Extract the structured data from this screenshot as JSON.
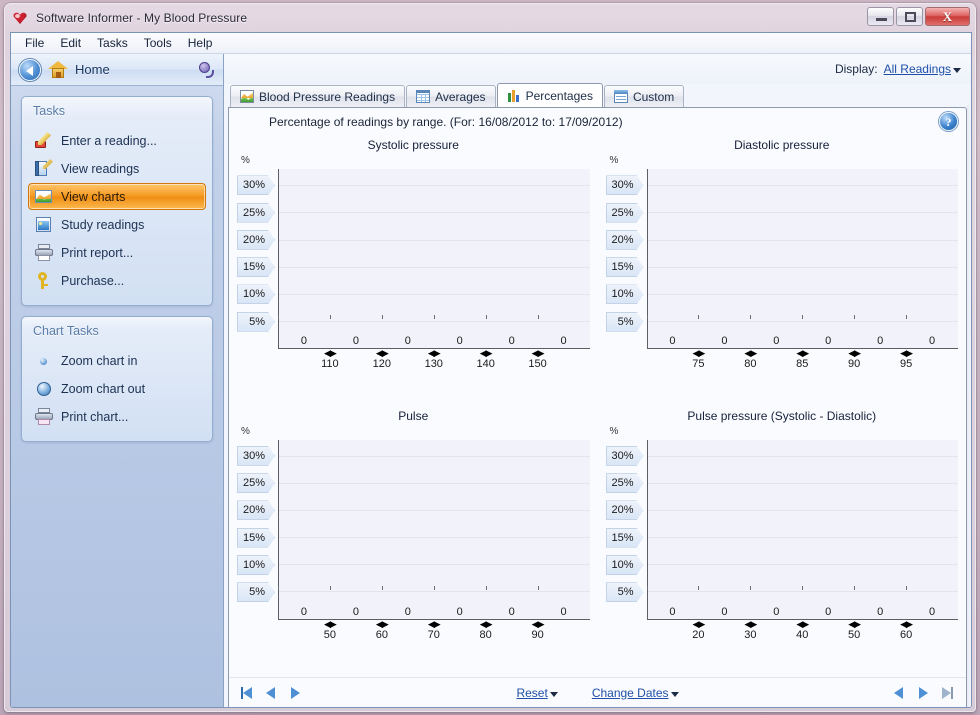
{
  "window": {
    "title": "Software Informer - My Blood Pressure",
    "icon": "heart-icon",
    "buttons": {
      "minimize": "Minimize",
      "maximize": "Maximize",
      "close": "X"
    }
  },
  "menubar": {
    "items": [
      "File",
      "Edit",
      "Tasks",
      "Tools",
      "Help"
    ]
  },
  "navbar": {
    "back": "Back",
    "home_label": "Home",
    "plug_icon": "plug-icon"
  },
  "sidebar": {
    "panels": [
      {
        "title": "Tasks",
        "items": [
          {
            "label": "Enter a reading...",
            "icon": "pen-icon",
            "selected": false
          },
          {
            "label": "View readings",
            "icon": "book-icon",
            "selected": false
          },
          {
            "label": "View charts",
            "icon": "chart-icon",
            "selected": true
          },
          {
            "label": "Study readings",
            "icon": "study-icon",
            "selected": false
          },
          {
            "label": "Print report...",
            "icon": "printer-icon",
            "selected": false
          },
          {
            "label": "Purchase...",
            "icon": "key-icon",
            "selected": false
          }
        ]
      },
      {
        "title": "Chart Tasks",
        "items": [
          {
            "label": "Zoom chart in",
            "icon": "zoom-in-icon",
            "selected": false
          },
          {
            "label": "Zoom chart out",
            "icon": "zoom-out-icon",
            "selected": false
          },
          {
            "label": "Print chart...",
            "icon": "print-chart-icon",
            "selected": false
          }
        ]
      }
    ]
  },
  "display": {
    "label": "Display:",
    "value": "All Readings"
  },
  "tabs": [
    {
      "label": "Blood Pressure Readings",
      "icon": "line-chart-icon",
      "active": false
    },
    {
      "label": "Averages",
      "icon": "grid-icon",
      "active": false
    },
    {
      "label": "Percentages",
      "icon": "bar-chart-icon",
      "active": true
    },
    {
      "label": "Custom",
      "icon": "custom-icon",
      "active": false
    }
  ],
  "content": {
    "subtitle": "Percentage of readings by range. (For: 16/08/2012 to: 17/09/2012)",
    "help": "?"
  },
  "bottombar": {
    "left_nav": [
      "first",
      "prev",
      "next"
    ],
    "right_nav": [
      "prev",
      "next",
      "last"
    ],
    "reset_label": "Reset",
    "change_dates_label": "Change Dates"
  },
  "chart_data": [
    {
      "type": "bar",
      "title": "Systolic pressure",
      "ylabel": "%",
      "xlabel": "",
      "categories": [
        "110",
        "120",
        "130",
        "140",
        "150"
      ],
      "bar_labels": [
        "0",
        "0",
        "0",
        "0",
        "0",
        "0"
      ],
      "values": [
        0,
        0,
        0,
        0,
        0,
        0
      ],
      "ytick_labels": [
        "30%",
        "25%",
        "20%",
        "15%",
        "10%",
        "5%"
      ],
      "ytick_values": [
        30,
        25,
        20,
        15,
        10,
        5
      ],
      "ylim": [
        0,
        33
      ],
      "grid": true,
      "legend": "none"
    },
    {
      "type": "bar",
      "title": "Diastolic pressure",
      "ylabel": "%",
      "xlabel": "",
      "categories": [
        "75",
        "80",
        "85",
        "90",
        "95"
      ],
      "bar_labels": [
        "0",
        "0",
        "0",
        "0",
        "0",
        "0"
      ],
      "values": [
        0,
        0,
        0,
        0,
        0,
        0
      ],
      "ytick_labels": [
        "30%",
        "25%",
        "20%",
        "15%",
        "10%",
        "5%"
      ],
      "ytick_values": [
        30,
        25,
        20,
        15,
        10,
        5
      ],
      "ylim": [
        0,
        33
      ],
      "grid": true,
      "legend": "none"
    },
    {
      "type": "bar",
      "title": "Pulse",
      "ylabel": "%",
      "xlabel": "",
      "categories": [
        "50",
        "60",
        "70",
        "80",
        "90"
      ],
      "bar_labels": [
        "0",
        "0",
        "0",
        "0",
        "0",
        "0"
      ],
      "values": [
        0,
        0,
        0,
        0,
        0,
        0
      ],
      "ytick_labels": [
        "30%",
        "25%",
        "20%",
        "15%",
        "10%",
        "5%"
      ],
      "ytick_values": [
        30,
        25,
        20,
        15,
        10,
        5
      ],
      "ylim": [
        0,
        33
      ],
      "grid": true,
      "legend": "none"
    },
    {
      "type": "bar",
      "title": "Pulse pressure (Systolic - Diastolic)",
      "ylabel": "%",
      "xlabel": "",
      "categories": [
        "20",
        "30",
        "40",
        "50",
        "60"
      ],
      "bar_labels": [
        "0",
        "0",
        "0",
        "0",
        "0",
        "0"
      ],
      "values": [
        0,
        0,
        0,
        0,
        0,
        0
      ],
      "ytick_labels": [
        "30%",
        "25%",
        "20%",
        "15%",
        "10%",
        "5%"
      ],
      "ytick_values": [
        30,
        25,
        20,
        15,
        10,
        5
      ],
      "ylim": [
        0,
        33
      ],
      "grid": true,
      "legend": "none"
    }
  ],
  "colors": {
    "accent": "#f59a22",
    "link": "#1f4fa8",
    "plot_bg": "#f2f3fa",
    "sidebar": "#b9cae6",
    "frame": "#cfb8c6"
  }
}
